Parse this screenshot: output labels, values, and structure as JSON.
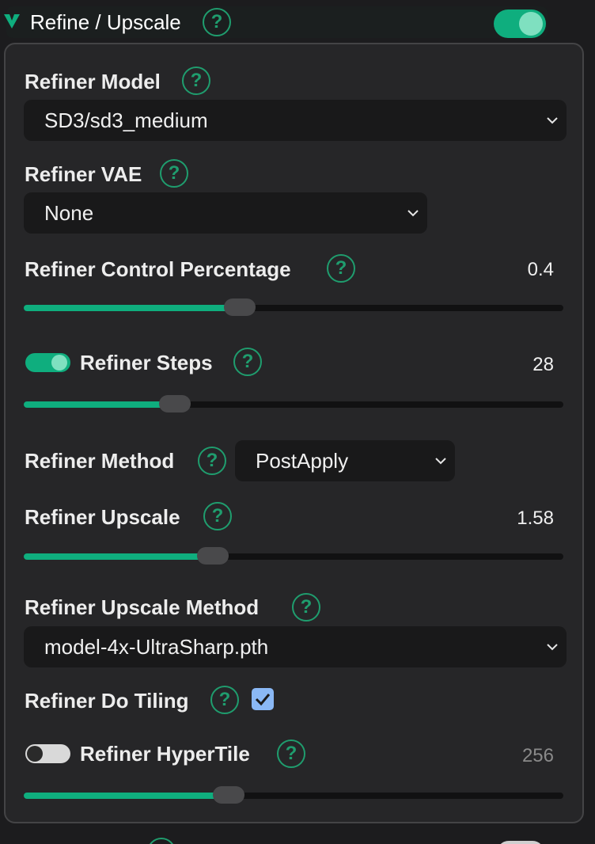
{
  "section": {
    "title": "Refine / Upscale",
    "help_glyph": "?",
    "enabled": true
  },
  "fields": {
    "refiner_model": {
      "label": "Refiner Model",
      "value": "SD3/sd3_medium"
    },
    "refiner_vae": {
      "label": "Refiner VAE",
      "value": "None"
    },
    "control_percentage": {
      "label": "Refiner Control Percentage",
      "value": "0.4",
      "slider_fraction": 0.4
    },
    "steps": {
      "label": "Refiner Steps",
      "value": "28",
      "enabled": true,
      "slider_fraction": 0.28
    },
    "method": {
      "label": "Refiner Method",
      "value": "PostApply"
    },
    "upscale": {
      "label": "Refiner Upscale",
      "value": "1.58",
      "slider_fraction": 0.35
    },
    "upscale_method": {
      "label": "Refiner Upscale Method",
      "value": "model-4x-UltraSharp.pth"
    },
    "do_tiling": {
      "label": "Refiner Do Tiling",
      "checked": true
    },
    "hypertile": {
      "label": "Refiner HyperTile",
      "value": "256",
      "enabled": false,
      "slider_fraction": 0.38
    }
  },
  "colors": {
    "accent": "#0fae7e",
    "help_green": "#1f9d6e",
    "checkbox": "#8ab8f5"
  },
  "icons": {
    "collapse": "chevron-down-icon",
    "dropdown": "chevron-down-icon",
    "help": "question-icon",
    "checkbox": "check-icon"
  }
}
